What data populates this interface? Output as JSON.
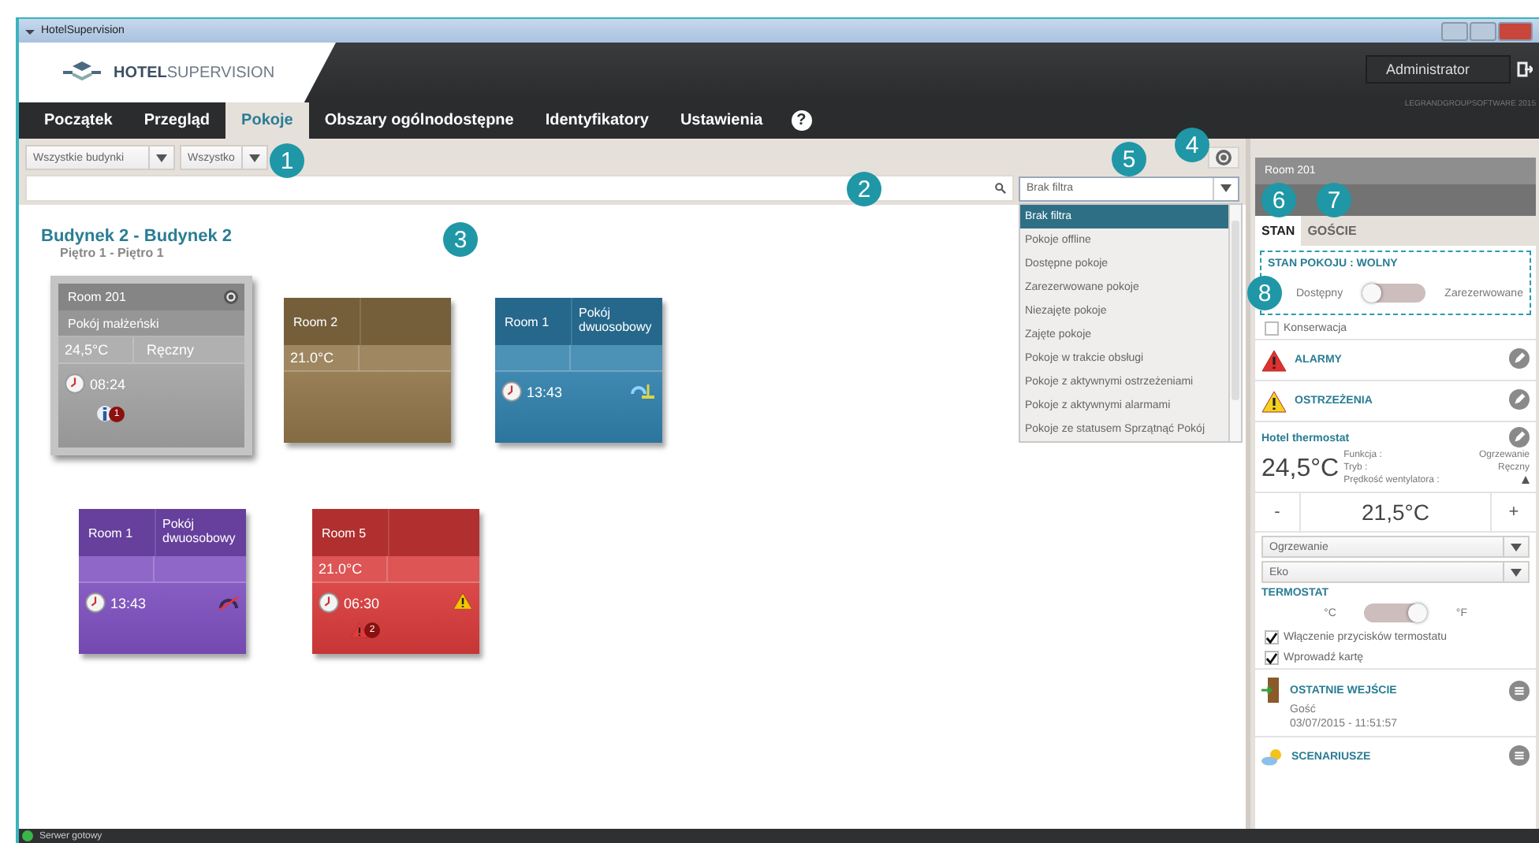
{
  "window": {
    "title": "HotelSupervision"
  },
  "header": {
    "logo": "**HOTEL**SUPERVISION",
    "user": "Administrator",
    "copyright": "LEGRANDGROUPSOFTWARE 2015"
  },
  "tabs": [
    {
      "label": "Początek",
      "selected": false
    },
    {
      "label": "Przegląd",
      "selected": false
    },
    {
      "label": "Pokoje",
      "selected": true
    },
    {
      "label": "Obszary ogólnodostępne",
      "selected": false
    },
    {
      "label": "Identyfikatory",
      "selected": false
    },
    {
      "label": "Ustawienia",
      "selected": false
    }
  ],
  "help": "?",
  "toolbar": {
    "building": "Wszystkie budynki",
    "floor": "Wszystko"
  },
  "filter": {
    "value": "Brak filtra",
    "expanded": true,
    "options": [
      {
        "label": "Brak filtra",
        "selected": true
      },
      {
        "label": "Pokoje offline",
        "selected": false
      },
      {
        "label": "Dostępne pokoje",
        "selected": false
      },
      {
        "label": "Zarezerwowane pokoje",
        "selected": false
      },
      {
        "label": "Niezajęte pokoje",
        "selected": false
      },
      {
        "label": "Zajęte pokoje",
        "selected": false
      },
      {
        "label": "Pokoje w trakcie obsługi",
        "selected": false
      },
      {
        "label": "Pokoje z aktywnymi ostrzeżeniami",
        "selected": false
      },
      {
        "label": "Pokoje z aktywnymi alarmami",
        "selected": false
      },
      {
        "label": "Pokoje ze statusem Sprzątnąć Pokój",
        "selected": false
      }
    ]
  },
  "building": {
    "title": "Budynek 2 - Budynek 2",
    "floor": "Piętro 1 - Piętro 1"
  },
  "rooms": [
    {
      "name": "Room 201",
      "subtitle": "Pokój małżeński",
      "temperature": "24,5°C",
      "mode": "Ręczny",
      "time": "08:24",
      "color": "#a3a3a3",
      "selected": true,
      "kind": "plain",
      "badge": {
        "kind": "info",
        "count": "1"
      }
    },
    {
      "name": "Room 2",
      "temperature": "21.0°C",
      "color": "#8f7448",
      "selected": false,
      "kind": "plain"
    },
    {
      "name": "Room 1",
      "type": "Pokój dwuosobowy",
      "time": "13:43",
      "kind": "cleaning",
      "color": "#2f7fab",
      "selected": false
    },
    {
      "name": "Room 1",
      "type": "Pokój dwuosobowy",
      "time": "13:43",
      "kind": "meter-off",
      "color": "#7d4fbf",
      "selected": false
    },
    {
      "name": "Room 5",
      "temperature": "21.0°C",
      "time": "06:30",
      "kind": "warning",
      "color": "#d83a3a",
      "selected": false,
      "badge": {
        "kind": "alarm",
        "count": "2"
      }
    }
  ],
  "panel": {
    "title": "Room 201",
    "tabs": [
      {
        "label": "STAN",
        "selected": true
      },
      {
        "label": "GOŚCIE",
        "selected": false
      }
    ],
    "room_state": {
      "title": "STAN POKOJU : WOLNY",
      "left": "Dostępny",
      "right": "Zarezerwowane",
      "on": false
    },
    "maintenance": {
      "label": "Konserwacja",
      "checked": false
    },
    "sections": [
      {
        "kind": "alarm",
        "label": "ALARMY"
      },
      {
        "kind": "warning",
        "label": "OSTRZEŻENIA"
      }
    ],
    "thermostat": {
      "title": "Hotel thermostat",
      "temperature": "24,5°C",
      "details": [
        {
          "label": "Funkcja :",
          "value": "Ogrzewanie"
        },
        {
          "label": "Tryb :",
          "value": "Ręczny"
        },
        {
          "label": "Prędkość wentylatora :"
        }
      ],
      "minus": "-",
      "setpoint": "21,5°C",
      "plus": "+",
      "function": "Ogrzewanie",
      "mode": "Eko",
      "unit_title": "TERMOSTAT",
      "unit_left": "°C",
      "unit_right": "°F",
      "unit_on": true,
      "options": [
        {
          "label": "Włączenie przycisków termostatu",
          "checked": true
        },
        {
          "label": "Wprowadź kartę",
          "checked": true
        }
      ]
    },
    "last_entry": {
      "title": "OSTATNIE WEJŚCIE",
      "who": "Gość",
      "when": "03/07/2015 - 11:51:57"
    },
    "scenarios": {
      "title": "SCENARIUSZE"
    }
  },
  "status_bar": {
    "text": "Serwer gotowy"
  },
  "callouts": [
    "1",
    "2",
    "3",
    "4",
    "5",
    "6",
    "7",
    "8"
  ]
}
